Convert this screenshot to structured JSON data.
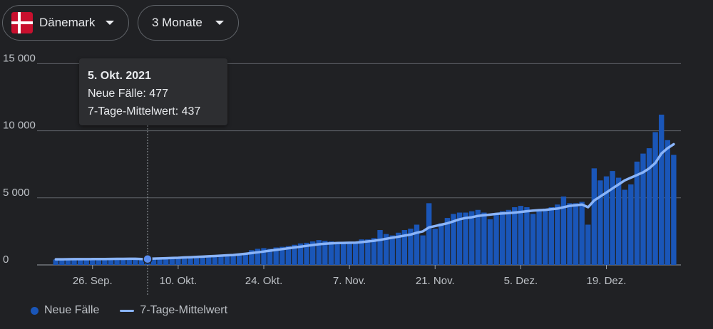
{
  "controls": {
    "country_label": "Dänemark",
    "range_label": "3 Monate"
  },
  "tooltip": {
    "date": "5. Okt. 2021",
    "cases_line": "Neue Fälle: 477",
    "avg_line": "7-Tage-Mittelwert: 437"
  },
  "legend": {
    "bars_label": "Neue Fälle",
    "line_label": "7-Tage-Mittelwert"
  },
  "colors": {
    "background": "#202124",
    "bar": "#1a56b8",
    "line": "#8ab4f8",
    "flag_red": "#c8102e",
    "flag_white": "#ffffff"
  },
  "chart_data": {
    "type": "bar",
    "ylim": [
      0,
      15500
    ],
    "y_ticks": [
      0,
      5000,
      10000,
      15000
    ],
    "y_tick_labels": [
      "0",
      "5 000",
      "10 000",
      "15 000"
    ],
    "x_start": "2021-09-20",
    "x_tick_labels": [
      {
        "date": "2021-09-26",
        "label": "26. Sep."
      },
      {
        "date": "2021-10-10",
        "label": "10. Okt."
      },
      {
        "date": "2021-10-24",
        "label": "24. Okt."
      },
      {
        "date": "2021-11-07",
        "label": "7. Nov."
      },
      {
        "date": "2021-11-21",
        "label": "21. Nov."
      },
      {
        "date": "2021-12-05",
        "label": "5. Dez."
      },
      {
        "date": "2021-12-19",
        "label": "19. Dez."
      }
    ],
    "grid": true,
    "legend_position": "bottom-left",
    "highlight_date": "2021-10-05",
    "series": [
      {
        "name": "Neue Fälle",
        "values": [
          400,
          420,
          380,
          410,
          400,
          430,
          440,
          420,
          450,
          460,
          470,
          450,
          480,
          470,
          460,
          477,
          500,
          520,
          550,
          560,
          540,
          580,
          600,
          620,
          650,
          700,
          680,
          720,
          750,
          800,
          850,
          900,
          1100,
          1200,
          1250,
          1200,
          1300,
          1350,
          1400,
          1500,
          1600,
          1650,
          1750,
          1850,
          1800,
          1750,
          1650,
          1700,
          1600,
          1650,
          1900,
          1900,
          2000,
          2600,
          2300,
          2200,
          2400,
          2600,
          2700,
          3000,
          2200,
          4600,
          2700,
          3100,
          3500,
          3800,
          3900,
          3900,
          4000,
          4100,
          3900,
          3400,
          3800,
          4000,
          4100,
          4300,
          4400,
          4300,
          3800,
          4000,
          4200,
          4300,
          4500,
          5100,
          4600,
          4600,
          4700,
          3000,
          7200,
          6300,
          6600,
          7000,
          6500,
          5600,
          6000,
          7700,
          8300,
          8700,
          9900,
          11200,
          9300,
          8200
        ],
        "avg": [
          420,
          420,
          425,
          428,
          430,
          432,
          434,
          436,
          440,
          445,
          450,
          452,
          455,
          458,
          440,
          437,
          470,
          485,
          500,
          515,
          530,
          555,
          575,
          595,
          615,
          640,
          665,
          690,
          715,
          740,
          780,
          830,
          880,
          940,
          1000,
          1060,
          1120,
          1180,
          1240,
          1300,
          1360,
          1420,
          1480,
          1540,
          1580,
          1610,
          1630,
          1640,
          1650,
          1660,
          1700,
          1750,
          1800,
          1870,
          1950,
          2030,
          2100,
          2180,
          2260,
          2400,
          2500,
          2800,
          2900,
          3000,
          3100,
          3250,
          3400,
          3500,
          3550,
          3650,
          3700,
          3750,
          3800,
          3830,
          3860,
          3900,
          3950,
          4000,
          4050,
          4080,
          4100,
          4150,
          4200,
          4300,
          4400,
          4450,
          4500,
          4300,
          4800,
          5100,
          5400,
          5700,
          6000,
          6300,
          6500,
          6700,
          6900,
          7200,
          7600,
          8300,
          8700,
          9000
        ]
      }
    ]
  }
}
